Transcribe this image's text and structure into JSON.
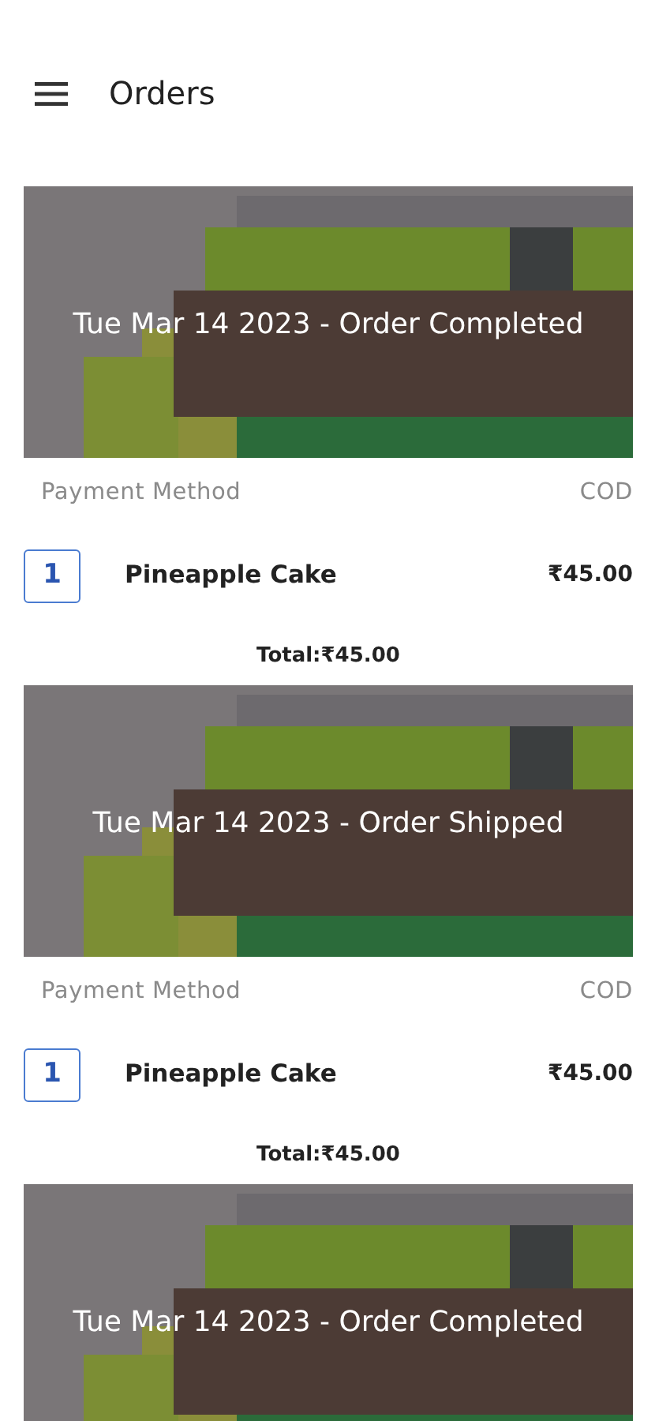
{
  "app_bar": {
    "title": "Orders"
  },
  "orders": [
    {
      "heading": "Tue Mar 14 2023 - Order Completed",
      "payment_label": "Payment Method",
      "payment_value": "COD",
      "items": [
        {
          "quantity": "1",
          "name": "Pineapple Cake",
          "price": "₹45.00"
        }
      ],
      "total": "Total:₹45.00"
    },
    {
      "heading": "Tue Mar 14 2023 - Order Shipped",
      "payment_label": "Payment Method",
      "payment_value": "COD",
      "items": [
        {
          "quantity": "1",
          "name": "Pineapple Cake",
          "price": "₹45.00"
        }
      ],
      "total": "Total:₹45.00"
    },
    {
      "heading": "Tue Mar 14 2023 - Order Completed"
    }
  ]
}
